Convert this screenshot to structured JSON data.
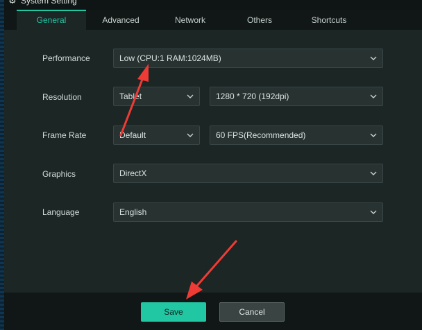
{
  "window": {
    "title": "System Setting",
    "title_icon": "gear-icon"
  },
  "tabs": [
    {
      "label": "General",
      "active": true
    },
    {
      "label": "Advanced",
      "active": false
    },
    {
      "label": "Network",
      "active": false
    },
    {
      "label": "Others",
      "active": false
    },
    {
      "label": "Shortcuts",
      "active": false
    }
  ],
  "settings": {
    "performance": {
      "label": "Performance",
      "value": "Low (CPU:1 RAM:1024MB)"
    },
    "resolution": {
      "label": "Resolution",
      "device": "Tablet",
      "size": "1280 * 720 (192dpi)"
    },
    "frame_rate": {
      "label": "Frame Rate",
      "mode": "Default",
      "fps": "60 FPS(Recommended)"
    },
    "graphics": {
      "label": "Graphics",
      "value": "DirectX"
    },
    "language": {
      "label": "Language",
      "value": "English"
    }
  },
  "buttons": {
    "save": "Save",
    "cancel": "Cancel"
  },
  "colors": {
    "accent": "#21c6a3",
    "annotation_arrow": "#ef3b35"
  },
  "annotations": [
    {
      "type": "arrow",
      "points_to": "performance-select"
    },
    {
      "type": "arrow",
      "points_to": "save-button"
    }
  ]
}
